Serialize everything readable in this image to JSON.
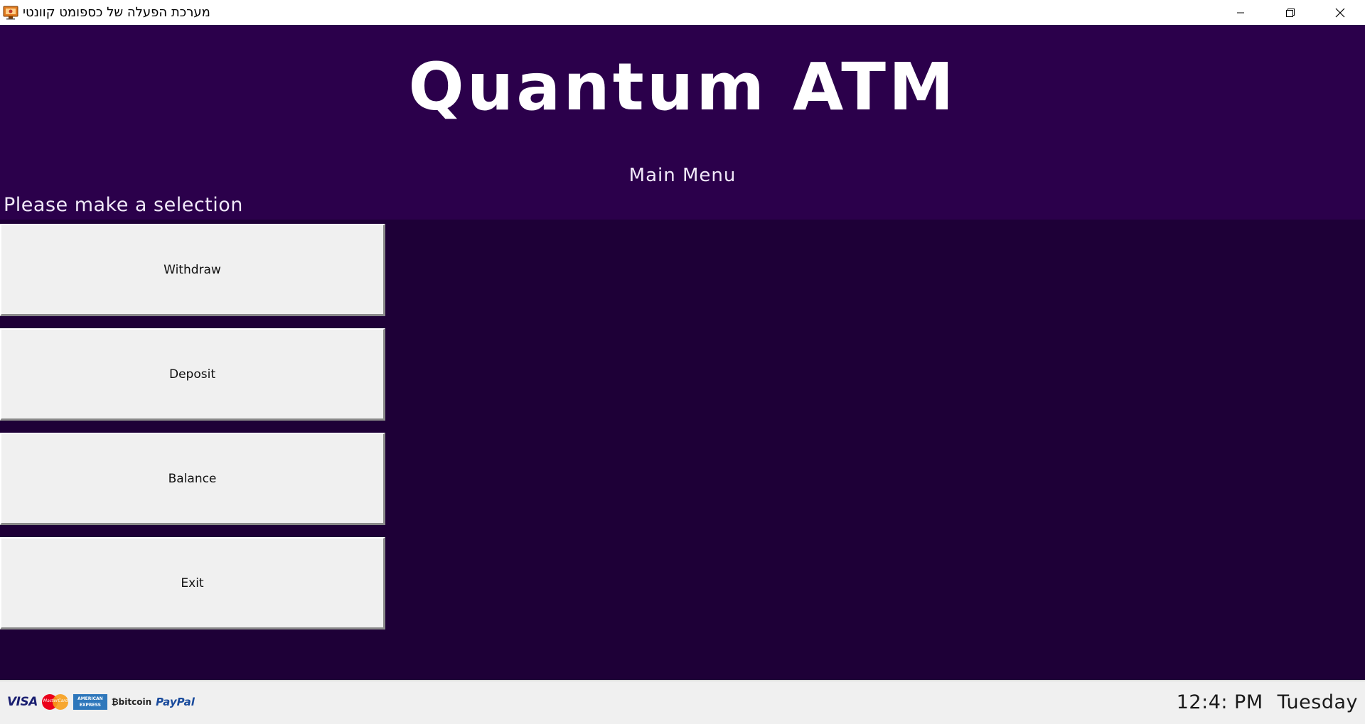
{
  "window": {
    "title": "מערכת הפעלה של כספומט קוונטי",
    "icon": "monitor-icon",
    "controls": [
      "minimize-icon",
      "restore-icon",
      "close-icon"
    ]
  },
  "header": {
    "brand": "Quantum ATM",
    "menu_title": "Main Menu",
    "prompt": "Please make a selection"
  },
  "menu": {
    "buttons": [
      {
        "label": "Withdraw"
      },
      {
        "label": "Deposit"
      },
      {
        "label": "Balance"
      },
      {
        "label": "Exit"
      }
    ]
  },
  "footer": {
    "payments": {
      "visa": "VISA",
      "mastercard": "MasterCard",
      "amex_line1": "AMERICAN",
      "amex_line2": "EXPRESS",
      "bitcoin": "bitcoin",
      "paypal": "PayPal"
    },
    "time": "12:4: PM",
    "day": "Tuesday"
  },
  "colors": {
    "header_bg": "#2b004b",
    "main_bg": "#1e0037",
    "button_bg": "#f0f0f0",
    "statusbar_bg": "#f0f0f0"
  }
}
